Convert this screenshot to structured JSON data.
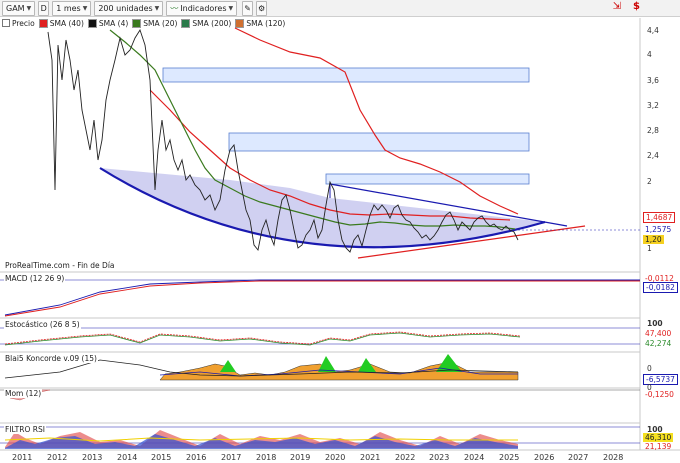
{
  "toolbar": {
    "symbol": "GAM",
    "d_button": "D",
    "period": "1 mes",
    "units": "200 unidades",
    "indicators": "Indicadores"
  },
  "legend": [
    {
      "label": "Precio",
      "color": "#222222"
    },
    {
      "label": "SMA (40)",
      "color": "#e02020"
    },
    {
      "label": "SMA (4)",
      "color": "#111111"
    },
    {
      "label": "SMA (20)",
      "color": "#3a7a1e"
    },
    {
      "label": "SMA (200)",
      "color": "#2a7a4a"
    },
    {
      "label": "SMA (120)",
      "color": "#d07030"
    }
  ],
  "source_text": "ProRealTime.com - Fin de Día",
  "price_axis": [
    "4,4",
    "4",
    "3,6",
    "3,2",
    "2,8",
    "2,4",
    "2",
    "1"
  ],
  "price_badges": {
    "sma40": "1,4687",
    "last": "1,2575",
    "close": "1,20"
  },
  "panels": {
    "macd": {
      "label": "MACD (12 26 9)",
      "badge_top": "-0,0112",
      "badge_bottom": "-0,0182"
    },
    "stoch": {
      "label": "Estocástico (26 8 5)",
      "axis_top": "100",
      "badge_top": "47,400",
      "badge_bottom": "42,274"
    },
    "koncorde": {
      "label": "Blai5 Koncorde v.09 (15)",
      "badge": "-6,5737",
      "axis": "0"
    },
    "mom": {
      "label": "Mom (12)",
      "axis": "0",
      "badge": "-0,1250"
    },
    "rsi": {
      "label": "FILTRO RSI",
      "axis_top": "100",
      "badge_top": "46,310",
      "badge_bottom": "21,139"
    }
  },
  "x_axis": [
    "2011",
    "2012",
    "2013",
    "2014",
    "2015",
    "2016",
    "2017",
    "2018",
    "2019",
    "2020",
    "2021",
    "2022",
    "2023",
    "2024",
    "2025",
    "2026",
    "2027",
    "2028"
  ],
  "colors": {
    "red": "#e02020",
    "blue": "#1a1ab0",
    "green": "#3a7a1e",
    "orange": "#f0a030",
    "fill": "#c8c8ee"
  }
}
